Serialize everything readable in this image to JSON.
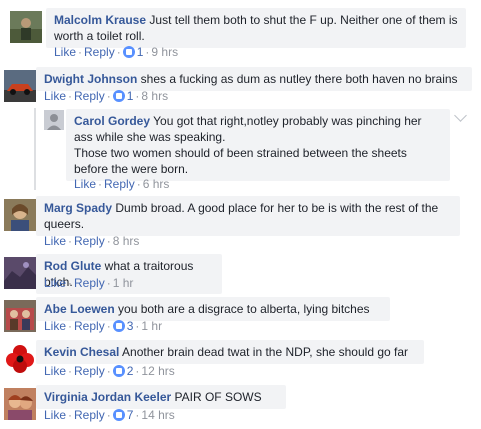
{
  "actions": {
    "like": "Like",
    "reply": "Reply",
    "sep": "·"
  },
  "comments": [
    {
      "name": "Malcolm Krause",
      "text": "Just tell them both to shut the F up. Neither one of them is worth a toilet roll.",
      "reactions": "1",
      "time": "9 hrs"
    },
    {
      "name": "Dwight Johnson",
      "text": "shes a fucking as dum as nutley there both haven no brains",
      "reactions": "1",
      "time": "8 hrs"
    },
    {
      "name": "Carol Gordey",
      "text": "You got that right,notley probably was pinching her ass while she was speaking.",
      "text2": "Those two women should of been strained between the sheets before the were born.",
      "time": "6 hrs"
    },
    {
      "name": "Marg Spady",
      "text": "Dumb broad. A good place for her to be is with the rest of the queers.",
      "time": "8 hrs"
    },
    {
      "name": "Rod Glute",
      "text": "what a traitorous btich.",
      "time": "1 hr"
    },
    {
      "name": "Abe Loewen",
      "text": "you both are a disgrace to alberta, lying bitches",
      "reactions": "3",
      "time": "1 hr"
    },
    {
      "name": "Kevin Chesal",
      "text": "Another brain dead twat in the NDP, she should go far",
      "reactions": "2",
      "time": "12 hrs"
    },
    {
      "name": "Virginia Jordan Keeler",
      "text": "PAIR OF SOWS",
      "reactions": "7",
      "time": "14 hrs"
    }
  ]
}
